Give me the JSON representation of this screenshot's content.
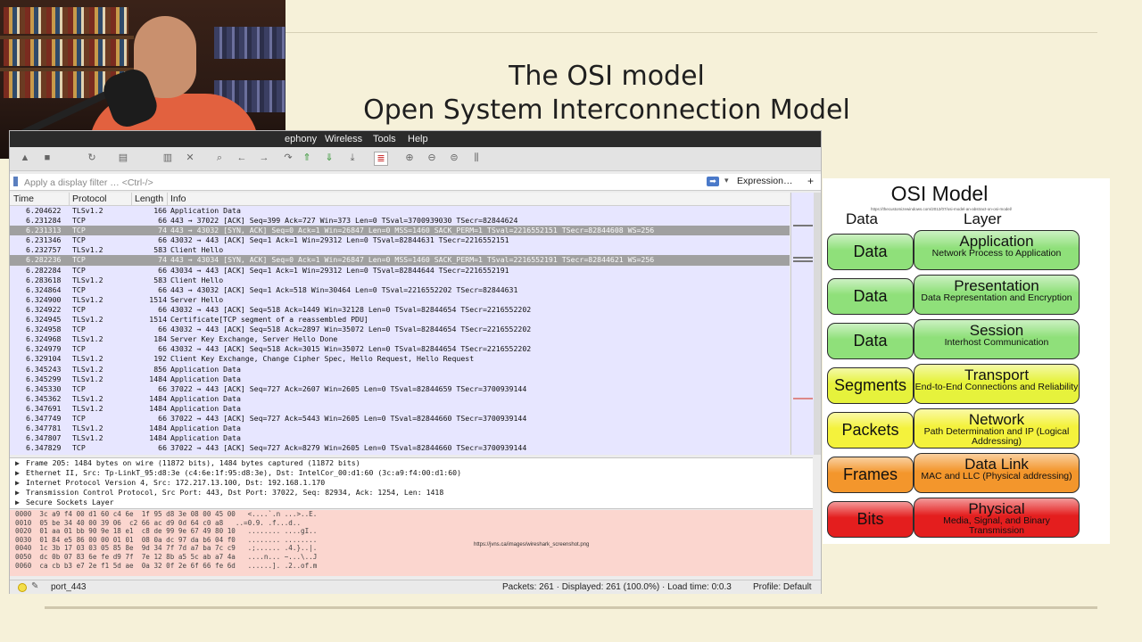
{
  "slide": {
    "title_line1": "The OSI model",
    "title_line2": "Open System Interconnection Model"
  },
  "menu": [
    "ephony",
    "Wireless",
    "Tools",
    "Help"
  ],
  "filter": {
    "placeholder": "Apply a display filter … <Ctrl-/>",
    "expression_label": "Expression…",
    "plus_label": "+"
  },
  "columns": [
    "Time",
    "Protocol",
    "Length",
    "Info"
  ],
  "packets": [
    {
      "time": "6.204622",
      "proto": "TLSv1.2",
      "len": "166",
      "info": "Application Data",
      "hl": false
    },
    {
      "time": "6.231284",
      "proto": "TCP",
      "len": "66",
      "info": "443 → 37022 [ACK] Seq=399 Ack=727 Win=373 Len=0 TSval=3700939030 TSecr=82844624",
      "hl": false
    },
    {
      "time": "6.231313",
      "proto": "TCP",
      "len": "74",
      "info": "443 → 43032 [SYN, ACK] Seq=0 Ack=1 Win=26847 Len=0 MSS=1460 SACK_PERM=1 TSval=2216552151 TSecr=82844608 WS=256",
      "hl": true
    },
    {
      "time": "6.231346",
      "proto": "TCP",
      "len": "66",
      "info": "43032 → 443 [ACK] Seq=1 Ack=1 Win=29312 Len=0 TSval=82844631 TSecr=2216552151",
      "hl": false
    },
    {
      "time": "6.232757",
      "proto": "TLSv1.2",
      "len": "583",
      "info": "Client Hello",
      "hl": false
    },
    {
      "time": "6.282236",
      "proto": "TCP",
      "len": "74",
      "info": "443 → 43034 [SYN, ACK] Seq=0 Ack=1 Win=26847 Len=0 MSS=1460 SACK_PERM=1 TSval=2216552191 TSecr=82844621 WS=256",
      "hl": true
    },
    {
      "time": "6.282284",
      "proto": "TCP",
      "len": "66",
      "info": "43034 → 443 [ACK] Seq=1 Ack=1 Win=29312 Len=0 TSval=82844644 TSecr=2216552191",
      "hl": false
    },
    {
      "time": "6.283618",
      "proto": "TLSv1.2",
      "len": "583",
      "info": "Client Hello",
      "hl": false
    },
    {
      "time": "6.324864",
      "proto": "TCP",
      "len": "66",
      "info": "443 → 43032 [ACK] Seq=1 Ack=518 Win=30464 Len=0 TSval=2216552202 TSecr=82844631",
      "hl": false
    },
    {
      "time": "6.324900",
      "proto": "TLSv1.2",
      "len": "1514",
      "info": "Server Hello",
      "hl": false
    },
    {
      "time": "6.324922",
      "proto": "TCP",
      "len": "66",
      "info": "43032 → 443 [ACK] Seq=518 Ack=1449 Win=32128 Len=0 TSval=82844654 TSecr=2216552202",
      "hl": false
    },
    {
      "time": "6.324945",
      "proto": "TLSv1.2",
      "len": "1514",
      "info": "Certificate[TCP segment of a reassembled PDU]",
      "hl": false
    },
    {
      "time": "6.324958",
      "proto": "TCP",
      "len": "66",
      "info": "43032 → 443 [ACK] Seq=518 Ack=2897 Win=35072 Len=0 TSval=82844654 TSecr=2216552202",
      "hl": false
    },
    {
      "time": "6.324968",
      "proto": "TLSv1.2",
      "len": "184",
      "info": "Server Key Exchange, Server Hello Done",
      "hl": false
    },
    {
      "time": "6.324979",
      "proto": "TCP",
      "len": "66",
      "info": "43032 → 443 [ACK] Seq=518 Ack=3015 Win=35072 Len=0 TSval=82844654 TSecr=2216552202",
      "hl": false
    },
    {
      "time": "6.329104",
      "proto": "TLSv1.2",
      "len": "192",
      "info": "Client Key Exchange, Change Cipher Spec, Hello Request, Hello Request",
      "hl": false
    },
    {
      "time": "6.345243",
      "proto": "TLSv1.2",
      "len": "856",
      "info": "Application Data",
      "hl": false
    },
    {
      "time": "6.345299",
      "proto": "TLSv1.2",
      "len": "1484",
      "info": "Application Data",
      "hl": false
    },
    {
      "time": "6.345330",
      "proto": "TCP",
      "len": "66",
      "info": "37022 → 443 [ACK] Seq=727 Ack=2607 Win=2605 Len=0 TSval=82844659 TSecr=3700939144",
      "hl": false
    },
    {
      "time": "6.345362",
      "proto": "TLSv1.2",
      "len": "1484",
      "info": "Application Data",
      "hl": false
    },
    {
      "time": "6.347691",
      "proto": "TLSv1.2",
      "len": "1484",
      "info": "Application Data",
      "hl": false
    },
    {
      "time": "6.347749",
      "proto": "TCP",
      "len": "66",
      "info": "37022 → 443 [ACK] Seq=727 Ack=5443 Win=2605 Len=0 TSval=82844660 TSecr=3700939144",
      "hl": false
    },
    {
      "time": "6.347781",
      "proto": "TLSv1.2",
      "len": "1484",
      "info": "Application Data",
      "hl": false
    },
    {
      "time": "6.347807",
      "proto": "TLSv1.2",
      "len": "1484",
      "info": "Application Data",
      "hl": false
    },
    {
      "time": "6.347829",
      "proto": "TCP",
      "len": "66",
      "info": "37022 → 443 [ACK] Seq=727 Ack=8279 Win=2605 Len=0 TSval=82844660 TSecr=3700939144",
      "hl": false
    }
  ],
  "details": [
    "Frame 205: 1484 bytes on wire (11872 bits), 1484 bytes captured (11872 bits)",
    "Ethernet II, Src: Tp-LinkT_95:d8:3e (c4:6e:1f:95:d8:3e), Dst: IntelCor_00:d1:60 (3c:a9:f4:00:d1:60)",
    "Internet Protocol Version 4, Src: 172.217.13.100, Dst: 192.168.1.170",
    "Transmission Control Protocol, Src Port: 443, Dst Port: 37022, Seq: 82934, Ack: 1254, Len: 1418",
    "Secure Sockets Layer"
  ],
  "bytes": [
    "0000  3c a9 f4 00 d1 60 c4 6e  1f 95 d8 3e 08 00 45 00   <....`.n ...>..E.",
    "0010  05 be 34 40 00 39 06  c2 66 ac d9 0d 64 c0 a8   ..=0.9. .f...d..",
    "0020  01 aa 01 bb 90 9e 18 e1  c8 de 99 9e 67 49 80 10   ........ ....gI..",
    "0030  01 84 e5 86 00 00 01 01  08 0a dc 97 da b6 04 f0   ........ ........",
    "0040  1c 3b 17 03 03 05 85 8e  9d 34 7f 7d a7 ba 7c c9   .;...... .4.}..|.",
    "0050  dc 0b 07 83 6e fe d9 7f  7e 12 8b a5 5c ab a7 4a   ....n... ~...\\..J",
    "0060  ca cb b3 e7 2e f1 5d ae  0a 32 0f 2e 6f 66 fe 6d   ......]. .2..of.m"
  ],
  "image_source": "https://jvns.ca/images/wireshark_screenshot.png",
  "status": {
    "profile": "port_443",
    "packets": "Packets: 261 · Displayed: 261 (100.0%) · Load time: 0:0.3",
    "profile_label": "Profile: Default"
  },
  "osi": {
    "title": "OSI Model",
    "source_url": "https://thecustomizewindows.com/2012/07/osi-model-an-abstract-on-osi-model/",
    "col_data": "Data",
    "col_layer": "Layer",
    "rows": [
      {
        "data": "Data",
        "layer": "Application",
        "desc": "Network Process to Application",
        "color": "#8fe07a"
      },
      {
        "data": "Data",
        "layer": "Presentation",
        "desc": "Data Representation and Encryption",
        "color": "#8fe07a"
      },
      {
        "data": "Data",
        "layer": "Session",
        "desc": "Interhost Communication",
        "color": "#8fe07a"
      },
      {
        "data": "Segments",
        "layer": "Transport",
        "desc": "End-to-End Connections and Reliability",
        "color": "#e6f23c"
      },
      {
        "data": "Packets",
        "layer": "Network",
        "desc": "Path Determination and IP (Logical Addressing)",
        "color": "#f4f23c"
      },
      {
        "data": "Frames",
        "layer": "Data Link",
        "desc": "MAC and LLC (Physical addressing)",
        "color": "#f3962c"
      },
      {
        "data": "Bits",
        "layer": "Physical",
        "desc": "Media, Signal, and Binary Transmission",
        "color": "#e41e1e"
      }
    ]
  }
}
